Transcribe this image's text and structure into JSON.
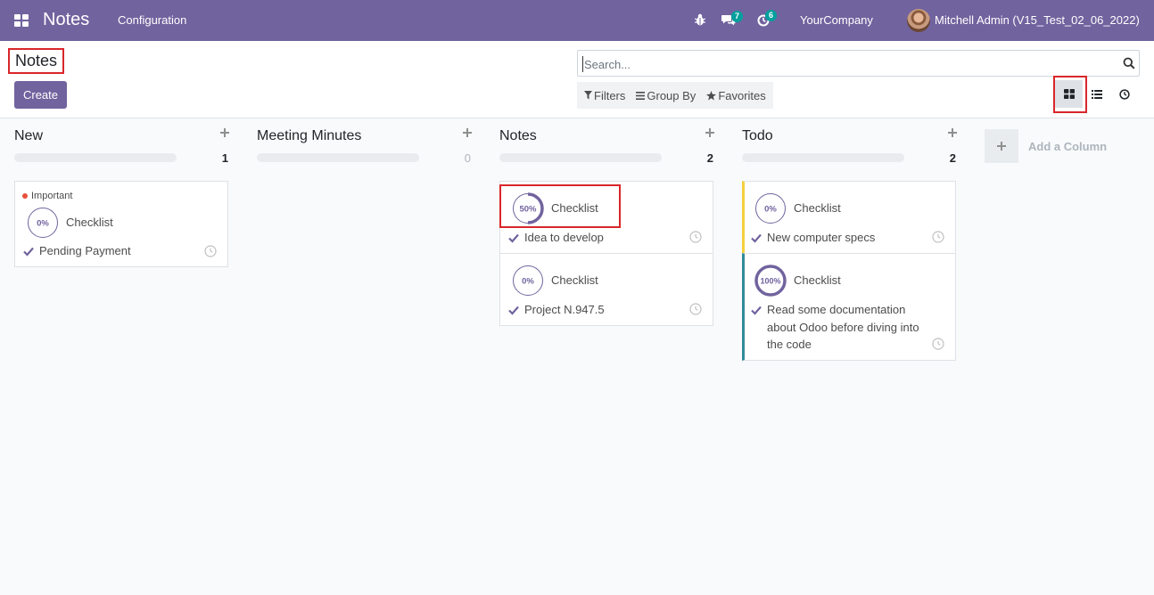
{
  "navbar": {
    "app_title": "Notes",
    "menu_configuration": "Configuration",
    "messages_count": "7",
    "activities_count": "6",
    "company": "YourCompany",
    "user": "Mitchell Admin (V15_Test_02_06_2022)",
    "bg_color": "#71639e"
  },
  "control_panel": {
    "title": "Notes",
    "create_label": "Create",
    "search_placeholder": "Search...",
    "filters_label": "Filters",
    "group_by_label": "Group By",
    "favorites_label": "Favorites",
    "active_view": "kanban"
  },
  "columns": [
    {
      "title": "New",
      "count": "1",
      "cards": [
        {
          "tag": "Important",
          "progress": "0%",
          "label": "Checklist",
          "text": "Pending Payment"
        }
      ]
    },
    {
      "title": "Meeting Minutes",
      "count": "0",
      "cards": []
    },
    {
      "title": "Notes",
      "count": "2",
      "cards": [
        {
          "progress": "50%",
          "label": "Checklist",
          "text": "Idea to develop"
        },
        {
          "progress": "0%",
          "label": "Checklist",
          "text": "Project N.947.5"
        }
      ]
    },
    {
      "title": "Todo",
      "count": "2",
      "cards": [
        {
          "progress": "0%",
          "label": "Checklist",
          "text": "New computer specs",
          "color": "#f4d03f"
        },
        {
          "progress": "100%",
          "label": "Checklist",
          "text": "Read some documentation about Odoo before diving into the code",
          "color": "#2e8b9a"
        }
      ]
    }
  ],
  "add_column_label": "Add a Column",
  "colors": {
    "accent": "#71639e",
    "highlight": "#d9262a",
    "important": "#e8503a"
  }
}
